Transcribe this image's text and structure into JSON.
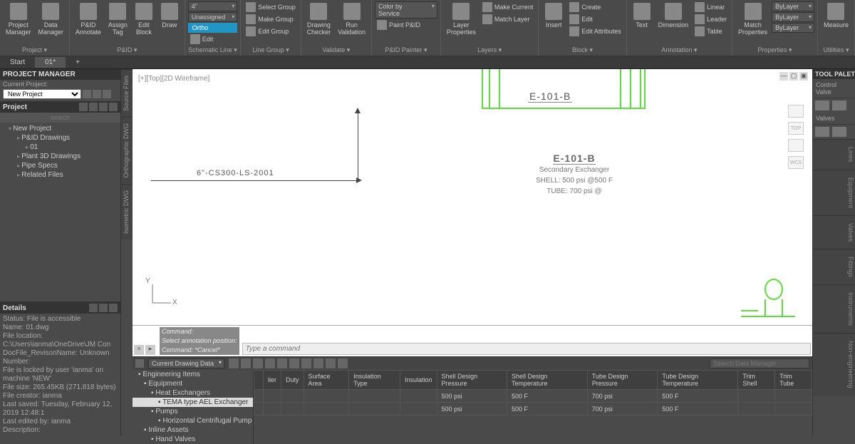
{
  "ribbon": {
    "groups": [
      {
        "title": "Project",
        "big": [
          {
            "label": "Project\nManager",
            "name": "project-manager-button"
          },
          {
            "label": "Data\nManager",
            "name": "data-manager-button"
          }
        ]
      },
      {
        "title": "P&ID",
        "big": [
          {
            "label": "P&ID\nAnnotate",
            "name": "pid-annotate-button"
          },
          {
            "label": "Assign\nTag",
            "name": "assign-tag-button"
          },
          {
            "label": "Edit\nBlock",
            "name": "edit-block-button"
          },
          {
            "label": "Draw",
            "name": "draw-button"
          }
        ]
      },
      {
        "title": "Schematic Line",
        "drops": [
          "4\"",
          "Unassigned"
        ],
        "ortho": "Ortho",
        "small": [
          {
            "label": "Edit",
            "name": "edit-button"
          }
        ]
      },
      {
        "title": "Line Group",
        "small": [
          {
            "label": "Select Group",
            "name": "select-group-button"
          },
          {
            "label": "Make Group",
            "name": "make-group-button"
          },
          {
            "label": "Edit Group",
            "name": "edit-group-button"
          }
        ]
      },
      {
        "title": "Validate",
        "big": [
          {
            "label": "Drawing\nChecker",
            "name": "drawing-checker-button"
          },
          {
            "label": "Run\nValidation",
            "name": "run-validation-button"
          }
        ]
      },
      {
        "title": "P&ID Painter",
        "small": [
          {
            "label": "Paint P&ID",
            "name": "paint-pid-button"
          }
        ],
        "drops": [
          "Color by Service"
        ]
      },
      {
        "title": "Layers",
        "big": [
          {
            "label": "Layer\nProperties",
            "name": "layer-properties-button"
          }
        ],
        "small": [
          {
            "label": "Make Current",
            "name": "make-current-button"
          },
          {
            "label": "Match Layer",
            "name": "match-layer-button"
          }
        ]
      },
      {
        "title": "Block",
        "big": [
          {
            "label": "Insert",
            "name": "insert-button"
          }
        ],
        "small": [
          {
            "label": "Create",
            "name": "create-button"
          },
          {
            "label": "Edit",
            "name": "edit-block-ribbon-button"
          },
          {
            "label": "Edit Attributes",
            "name": "edit-attributes-button"
          }
        ]
      },
      {
        "title": "Annotation",
        "big": [
          {
            "label": "Text",
            "name": "text-button"
          },
          {
            "label": "Dimension",
            "name": "dimension-button"
          }
        ],
        "small": [
          {
            "label": "Linear",
            "name": "linear-button"
          },
          {
            "label": "Leader",
            "name": "leader-button"
          },
          {
            "label": "Table",
            "name": "table-button"
          }
        ]
      },
      {
        "title": "Properties",
        "big": [
          {
            "label": "Match\nProperties",
            "name": "match-properties-button"
          }
        ],
        "drops": [
          "ByLayer",
          "ByLayer",
          "ByLayer"
        ]
      },
      {
        "title": "Utilities",
        "big": [
          {
            "label": "Measure",
            "name": "measure-button"
          }
        ]
      }
    ]
  },
  "tabs": [
    {
      "label": "Start",
      "active": false
    },
    {
      "label": "01*",
      "active": true
    }
  ],
  "projectManager": {
    "title": "PROJECT MANAGER",
    "currentProjectLabel": "Current Project:",
    "currentProject": "New Project",
    "projectHeader": "Project",
    "search": "search",
    "tree": [
      {
        "label": "New Project",
        "cls": "l1"
      },
      {
        "label": "P&ID Drawings",
        "cls": "l2"
      },
      {
        "label": "01",
        "cls": "l2",
        "indent": 36
      },
      {
        "label": "Plant 3D Drawings",
        "cls": "l2"
      },
      {
        "label": "Pipe Specs",
        "cls": "l2"
      },
      {
        "label": "Related Files",
        "cls": "l2"
      }
    ]
  },
  "details": {
    "title": "Details",
    "rows": [
      "Status: File is accessible",
      "Name: 01.dwg",
      "File location: C:\\Users\\ianma\\OneDrive\\JM Con",
      "DocFile_RevisonName: Unknown",
      "Number:",
      "File is locked by user 'ianma' on machine 'NEW'",
      "File size: 265.45KB (271,818 bytes)",
      "File creator: ianma",
      "Last saved: Tuesday, February 12, 2019 12:48:1",
      "Last edited by: ianma",
      "Description:"
    ]
  },
  "sourceTabs": [
    "Source Files",
    "Orthographic DWG",
    "Isometric DWG"
  ],
  "canvas": {
    "label": "[+][Top][2D Wireframe]",
    "navCube": [
      "",
      "TOP",
      "",
      "WCS"
    ],
    "lineTag": "6\"-CS300-LS-2001",
    "exchanger": {
      "tag": "E-101-B",
      "title": "E-101-B",
      "desc": "Secondary Exchanger",
      "shell": "SHELL: 500 psi @500 F",
      "tube": "TUBE: 700 psi @"
    },
    "cmdHistory": [
      "Command:",
      "Select annotation position:",
      "Command: *Cancel*"
    ],
    "cmdPlaceholder": "Type a command"
  },
  "dataManager": {
    "drop": "Current Drawing Data",
    "searchPlaceholder": "Search Data Manager",
    "tree": [
      {
        "label": "Engineering Items",
        "cls": ""
      },
      {
        "label": "Equipment",
        "cls": "d1"
      },
      {
        "label": "Heat Exchangers",
        "cls": "d2"
      },
      {
        "label": "TEMA type AEL Exchanger",
        "cls": "d3"
      },
      {
        "label": "Pumps",
        "cls": "d2"
      },
      {
        "label": "Horizontal Centrifugal Pump",
        "cls": "d2",
        "indent": 36
      },
      {
        "label": "Inline Assets",
        "cls": "d1"
      },
      {
        "label": "Hand Valves",
        "cls": "d2"
      }
    ],
    "columns": [
      "",
      "lier",
      "Duty",
      "Surface Area",
      "Insulation Type",
      "Insulation",
      "Shell Design Pressure",
      "Shell Design Temperature",
      "Tube Design Pressure",
      "Tube Design Temperature",
      "Trim Shell",
      "Trim Tube"
    ],
    "rows": [
      [
        "",
        "",
        "",
        "",
        "",
        "",
        "500 psi",
        "500 F",
        "700 psi",
        "500 F",
        "",
        ""
      ],
      [
        "",
        "",
        "",
        "",
        "",
        "",
        "500 psi",
        "500 F",
        "700 psi",
        "500 F",
        "",
        ""
      ]
    ]
  },
  "palettes": {
    "title": "TOOL PALETTES -",
    "cats": [
      "Control Valve",
      "Valves"
    ],
    "sideTabs": [
      "Lines",
      "Equipment",
      "Valves",
      "Fittings",
      "Instruments",
      "Non-engineering"
    ]
  }
}
